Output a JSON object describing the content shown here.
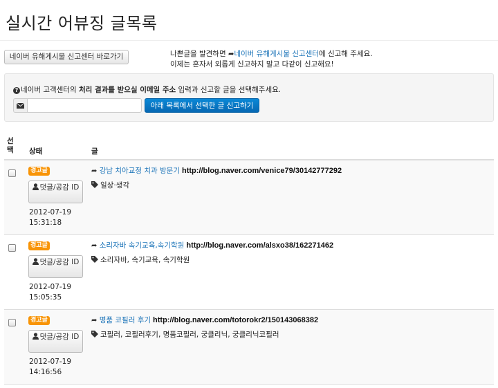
{
  "page": {
    "title": "실시간 어뷰징 글목록"
  },
  "toolbar": {
    "report_center_button": "네이버 유해게시물 신고센터 바로가기"
  },
  "notice": {
    "line1_prefix": "나쁜글을 발견하면 ",
    "line1_link": "네이버 유해게시물 신고센터",
    "line1_suffix": "에 신고해 주세요.",
    "line2": "이제는 혼자서 외롭게 신고하지 말고 다같이 신고해요!"
  },
  "form": {
    "hint_prefix": "네이버 고객센터의 ",
    "hint_bold": "처리 결과를 받으실 이메일 주소",
    "hint_suffix": " 입력과 신고할 글을 선택해주세요.",
    "email_value": "",
    "submit_button": "아래 목록에서 선택한 글 신고하기"
  },
  "table": {
    "headers": {
      "select": "선택",
      "status": "상태",
      "post": "글"
    },
    "rows": [
      {
        "badge": "경고글",
        "reply_button": "댓글/공감 ID",
        "date": "2012-07-19",
        "time": "15:31:18",
        "title": "강남 치아교정 치과 방문기",
        "url": "http://blog.naver.com/venice79/30142777292",
        "tags": "일상·생각"
      },
      {
        "badge": "경고글",
        "reply_button": "댓글/공감 ID",
        "date": "2012-07-19",
        "time": "15:05:35",
        "title": "소리자바 속기교육,속기학원",
        "url": "http://blog.naver.com/alsxo38/162271462",
        "tags": "소리자바, 속기교육, 속기학원"
      },
      {
        "badge": "경고글",
        "reply_button": "댓글/공감 ID",
        "date": "2012-07-19",
        "time": "14:16:56",
        "title": "명품 코필러 후기",
        "url": "http://blog.naver.com/totorokr2/150143068382",
        "tags": "코필러, 코필러후기, 명품코필러, 궁클리닉, 궁클리닉코필러"
      }
    ]
  },
  "icons": {
    "share_arrow": "share-arrow-icon",
    "help": "question-circle-icon",
    "mail": "envelope-icon",
    "user": "user-icon",
    "tag": "tag-icon"
  },
  "colors": {
    "link": "#1a73b8",
    "badge_warning": "#f89406",
    "primary_button": "#0668b3"
  }
}
